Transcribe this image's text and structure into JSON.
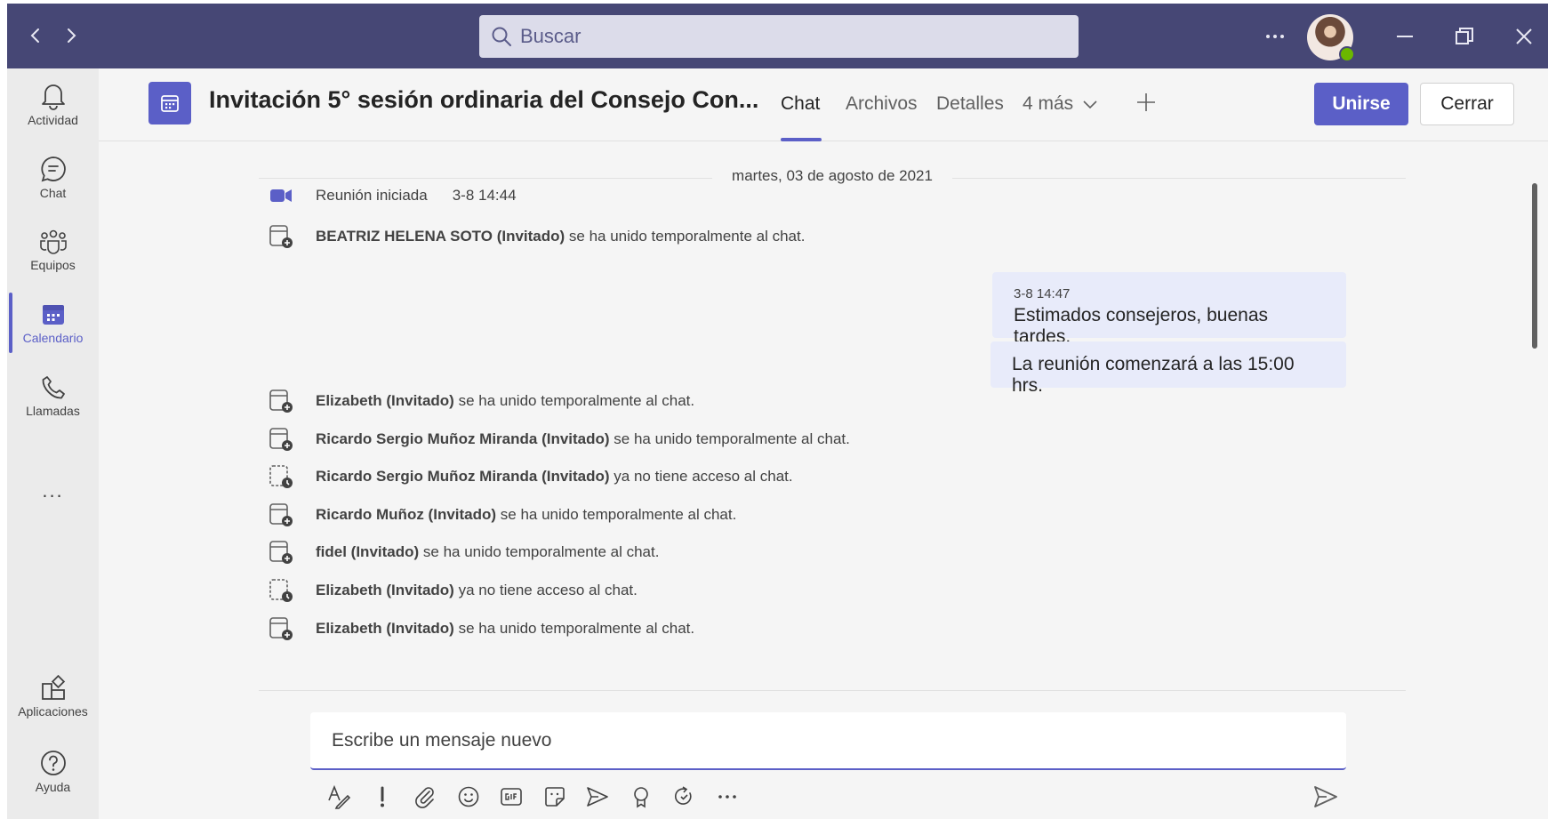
{
  "search": {
    "placeholder": "Buscar"
  },
  "rail": {
    "activity": "Actividad",
    "chat": "Chat",
    "teams": "Equipos",
    "calendar": "Calendario",
    "calls": "Llamadas",
    "more": "...",
    "apps": "Aplicaciones",
    "help": "Ayuda"
  },
  "header": {
    "title": "Invitación 5° sesión ordinaria del Consejo Con...",
    "tabs": {
      "chat": "Chat",
      "files": "Archivos",
      "details": "Detalles",
      "more": "4 más"
    },
    "join": "Unirse",
    "close": "Cerrar"
  },
  "messages": {
    "date": "martes, 03 de agosto de 2021",
    "meeting_started": {
      "text": "Reunión iniciada",
      "time": "3-8 14:44"
    },
    "events": [
      {
        "name": "BEATRIZ HELENA SOTO (Invitado)",
        "action": " se ha unido temporalmente al chat.",
        "type": "joined"
      },
      {
        "name": "Elizabeth (Invitado)",
        "action": " se ha unido temporalmente al chat.",
        "type": "joined"
      },
      {
        "name": "Ricardo Sergio Muñoz Miranda (Invitado)",
        "action": " se ha unido temporalmente al chat.",
        "type": "joined"
      },
      {
        "name": "Ricardo Sergio Muñoz Miranda (Invitado)",
        "action": " ya no tiene acceso al chat.",
        "type": "left"
      },
      {
        "name": "Ricardo Muñoz (Invitado)",
        "action": " se ha unido temporalmente al chat.",
        "type": "joined"
      },
      {
        "name": "fidel (Invitado)",
        "action": " se ha unido temporalmente al chat.",
        "type": "joined"
      },
      {
        "name": "Elizabeth (Invitado)",
        "action": " ya no tiene acceso al chat.",
        "type": "left"
      },
      {
        "name": "Elizabeth (Invitado)",
        "action": " se ha unido temporalmente al chat.",
        "type": "joined"
      }
    ],
    "own_messages": [
      {
        "time": "3-8 14:47",
        "text": "Estimados consejeros, buenas tardes."
      },
      {
        "text": "La reunión comenzará a las 15:00 hrs."
      }
    ]
  },
  "compose": {
    "placeholder": "Escribe un mensaje nuevo"
  },
  "colors": {
    "titlebar": "#464775",
    "accent": "#5b5fc7",
    "bubble": "#e8ebfa"
  }
}
